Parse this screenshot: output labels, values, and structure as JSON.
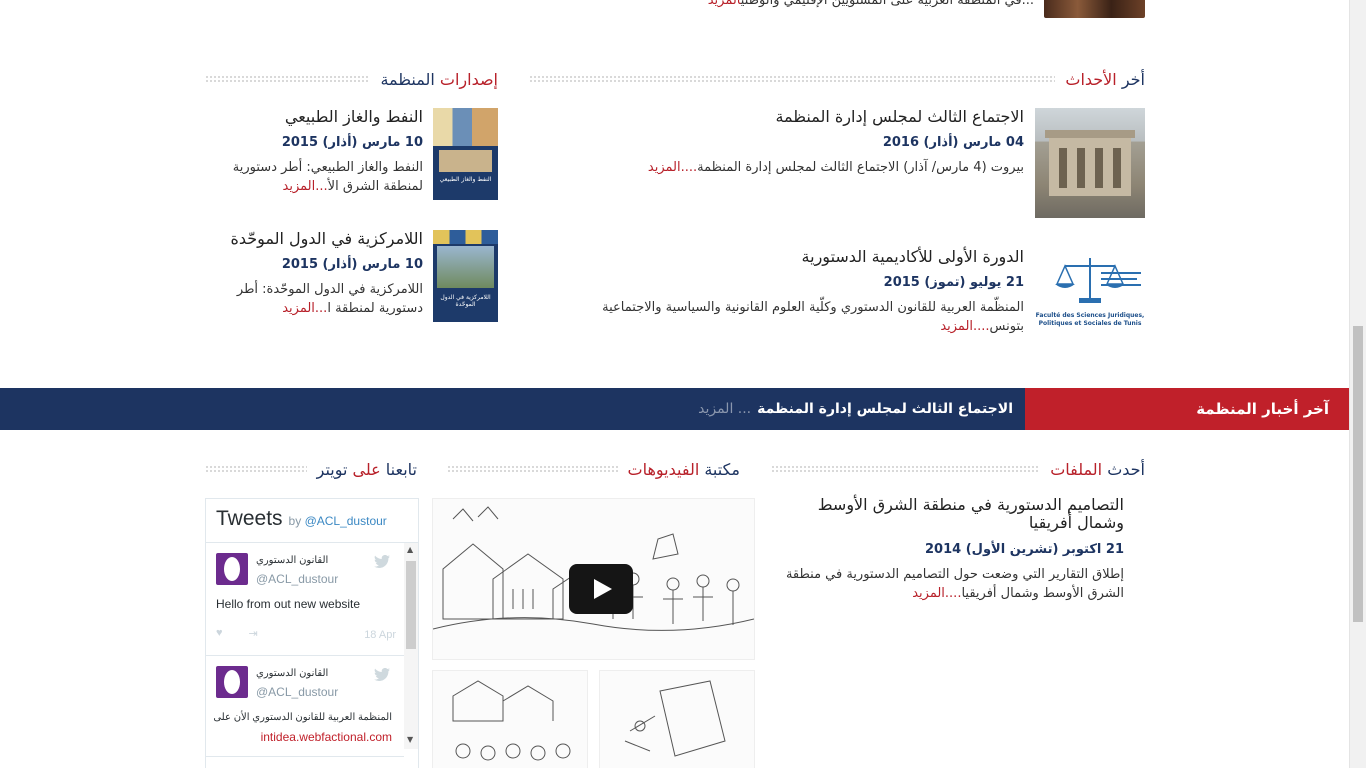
{
  "top_snippet": {
    "text": "...في المنطقة العربية على المستويين الإقليمي والوطني",
    "more": "المزيد"
  },
  "events": {
    "title_red": "أخر ",
    "title_dark": "الأحداث",
    "items": [
      {
        "heading": "الاجتماع الثالث لمجلس إدارة المنظمة",
        "date": "04 مارس (أذار) 2016",
        "text": "بيروت (4 مارس/ آذار) الاجتماع الثالث لمجلس إدارة المنظمة",
        "ellipsis": "....",
        "more": "المزيد"
      },
      {
        "heading": "الدورة الأولى للأكاديمية الدستورية",
        "date": "21 يوليو (تموز) 2015",
        "text": "المنظّمة العربية للقانون الدستوري وكلّية العلوم القانونية والسياسية والاجتماعية بتونس",
        "ellipsis": "....",
        "more": "المزيد",
        "logo_text": "Faculté des Sciences Juridiques, Politiques et Sociales de Tunis"
      }
    ]
  },
  "publications": {
    "title_dark": "إصدارات ",
    "title_red": "المنظمة",
    "items": [
      {
        "heading": "النفط والغاز الطبيعي",
        "date": "10 مارس (أذار) 2015",
        "text": "النفط والغاز الطبيعي: أطر دستورية لمنطقة الشرق الأ",
        "ellipsis": "...",
        "more": "المزيد",
        "cover_title": "النفط والغاز الطبيعي"
      },
      {
        "heading": "اللامركزية في الدول الموحّدة",
        "date": "10 مارس (أذار) 2015",
        "text": "اللامركزية في الدول الموحّدة: أطر دستورية لمنطقة ا",
        "ellipsis": "...",
        "more": "المزيد",
        "cover_title": "اللامركزية في الدول الموحّدة"
      }
    ]
  },
  "ticker": {
    "label": "آخر أخبار المنظمة",
    "headline": "الاجتماع الثالث لمجلس إدارة المنظمة",
    "more": "... المزيد"
  },
  "files": {
    "title_dark": "أحدث ",
    "title_red": "الملفات",
    "item": {
      "heading": "التصاميم الدستورية في منطقة الشرق الأوسط وشمال أفريقيا",
      "date": "21 اكتوبر (تشرين الأول) 2014",
      "text": "إطلاق التقارير التي وضعت حول التصاميم الدستورية في منطقة الشرق الأوسط وشمال أفريقيا",
      "ellipsis": "....",
      "more": "المزيد"
    }
  },
  "videos": {
    "title_dark": "مكتبة ",
    "title_red": "الفيديوهات"
  },
  "twitter": {
    "title_dark": "تابعنا ",
    "title_red": "على ",
    "title_dark2": "تويتر",
    "header": "Tweets",
    "by": "by",
    "handle": "@ACL_dustour",
    "tweets": [
      {
        "name": "القانون الدستوري",
        "handle": "@ACL_dustour",
        "text": "Hello from out new website",
        "date": "18 Apr"
      },
      {
        "name": "القانون الدستوري",
        "handle": "@ACL_dustour",
        "text": "المنظمة العربية للقانون الدستوري الأن على",
        "link": "intidea.webfactional.com"
      }
    ]
  },
  "colors": {
    "navy": "#1d3461",
    "red": "#b8212a",
    "ticker_red": "#c0202a"
  }
}
